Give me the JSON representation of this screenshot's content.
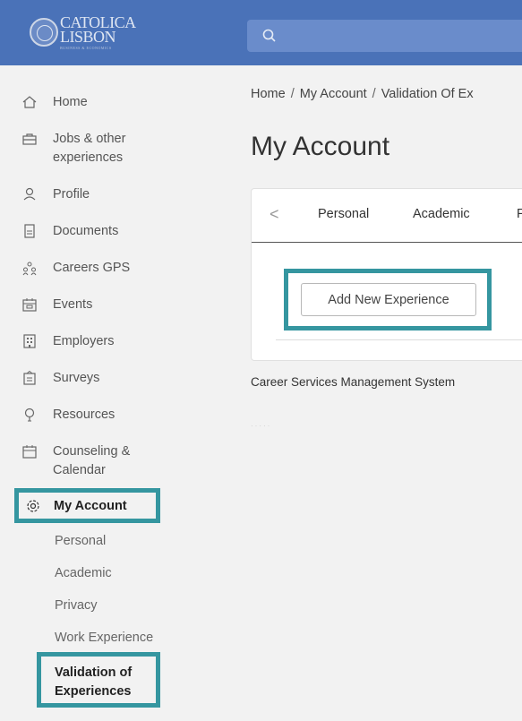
{
  "header": {
    "logo_line1": "CATOLICA",
    "logo_line2": "LISBON",
    "logo_line3": "BUSINESS & ECONOMICS"
  },
  "sidebar": {
    "items": [
      {
        "label": "Home",
        "icon": "home-icon"
      },
      {
        "label": "Jobs & other",
        "label2": "experiences",
        "icon": "briefcase-icon"
      },
      {
        "label": "Profile",
        "icon": "user-icon"
      },
      {
        "label": "Documents",
        "icon": "document-icon"
      },
      {
        "label": "Careers GPS",
        "icon": "people-icon"
      },
      {
        "label": "Events",
        "icon": "calendar-icon"
      },
      {
        "label": "Employers",
        "icon": "building-icon"
      },
      {
        "label": "Surveys",
        "icon": "clipboard-icon"
      },
      {
        "label": "Resources",
        "icon": "lightbulb-icon"
      },
      {
        "label": "Counseling &",
        "label2": "Calendar",
        "icon": "calendar-icon"
      },
      {
        "label": "My Account",
        "icon": "gear-icon"
      }
    ],
    "subitems": [
      {
        "label": "Personal"
      },
      {
        "label": "Academic"
      },
      {
        "label": "Privacy"
      },
      {
        "label": "Work Experience"
      },
      {
        "label": "Validation of",
        "label2": "Experiences"
      }
    ]
  },
  "breadcrumb": [
    "Home",
    "My Account",
    "Validation Of Ex"
  ],
  "page_title": "My Account",
  "tabs": {
    "prev": "<",
    "items": [
      "Personal",
      "Academic",
      "F"
    ]
  },
  "add_button": "Add New Experience",
  "footer": "Career Services Management System",
  "colors": {
    "header_bg": "#4a72b8",
    "search_bg": "#6a8ccb",
    "highlight": "#3596a0",
    "page_bg": "#f2f2f2"
  }
}
